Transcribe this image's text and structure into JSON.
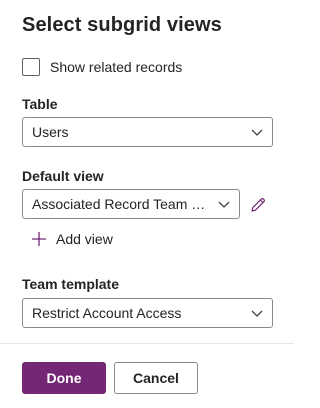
{
  "panel": {
    "title": "Select subgrid views"
  },
  "show_related": {
    "label": "Show related records",
    "checked": false
  },
  "table": {
    "label": "Table",
    "value": "Users"
  },
  "default_view": {
    "label": "Default view",
    "value": "Associated Record Team M..."
  },
  "add_view": {
    "label": "Add view"
  },
  "team_template": {
    "label": "Team template",
    "value": "Restrict Account Access"
  },
  "footer": {
    "done_label": "Done",
    "cancel_label": "Cancel"
  },
  "icons": {
    "chevron": "chevron-down-icon",
    "edit": "pencil-icon",
    "add": "plus-icon"
  },
  "colors": {
    "accent": "#742774",
    "border": "#8a8a8a"
  }
}
